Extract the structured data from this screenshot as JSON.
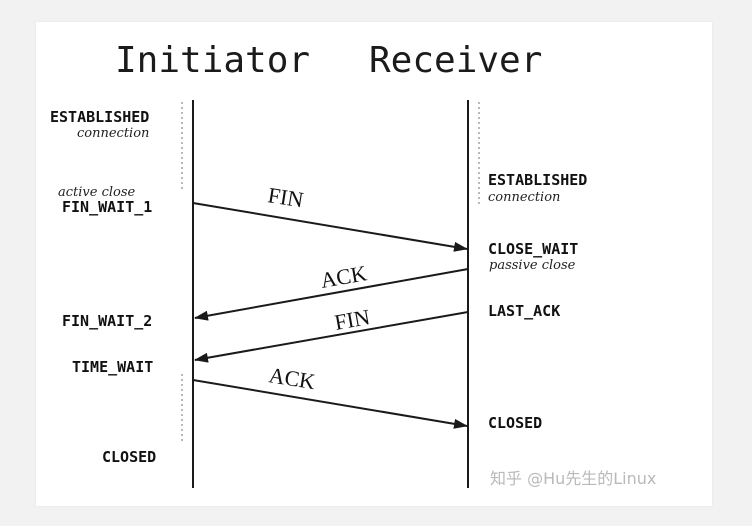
{
  "title": {
    "initiator": "Initiator",
    "receiver": "Receiver"
  },
  "initiator_states": {
    "established": "ESTABLISHED",
    "established_note": "connection",
    "active_close_note": "active close",
    "fin_wait_1": "FIN_WAIT_1",
    "fin_wait_2": "FIN_WAIT_2",
    "time_wait": "TIME_WAIT",
    "closed": "CLOSED"
  },
  "receiver_states": {
    "established": "ESTABLISHED",
    "established_note": "connection",
    "close_wait": "CLOSE_WAIT",
    "passive_close_note": "passive close",
    "last_ack": "LAST_ACK",
    "closed": "CLOSED"
  },
  "messages": {
    "fin_1": "FIN",
    "ack_1": "ACK",
    "fin_2": "FIN",
    "ack_2": "ACK"
  },
  "watermark": "知乎 @Hu先生的Linux",
  "colors": {
    "line": "#1a1a1a",
    "text": "#111111",
    "watermark": "#b9b9b9",
    "background": "#ffffff"
  }
}
